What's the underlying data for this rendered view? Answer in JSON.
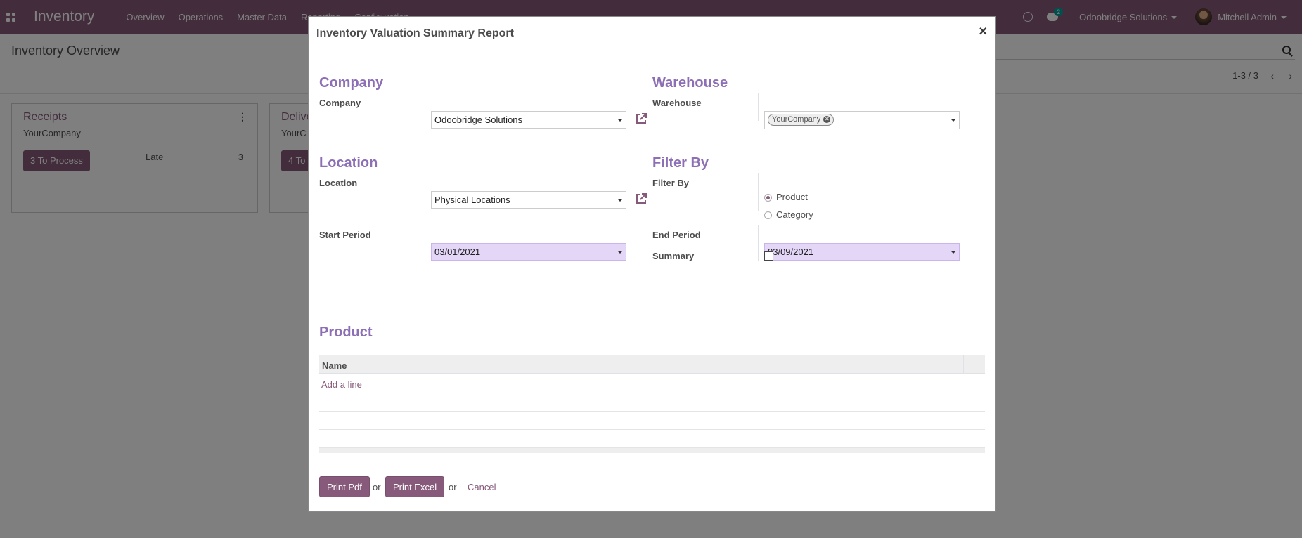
{
  "navbar": {
    "app_name": "Inventory",
    "menu": [
      "Overview",
      "Operations",
      "Master Data",
      "Reporting",
      "Configuration"
    ],
    "chat_count": "2",
    "company": "Odoobridge Solutions",
    "user": "Mitchell Admin"
  },
  "control_panel": {
    "title": "Inventory Overview",
    "pager": "1-3 / 3"
  },
  "cards": [
    {
      "title": "Receipts",
      "subtitle": "YourCompany",
      "button": "3 To Process",
      "late_label": "Late",
      "late_count": "3"
    },
    {
      "title": "Delive",
      "subtitle": "YourC",
      "button": "4 To"
    }
  ],
  "modal": {
    "title": "Inventory Valuation Summary Report",
    "close": "×",
    "company_group": {
      "title": "Company",
      "label": "Company",
      "value": "Odoobridge Solutions"
    },
    "warehouse_group": {
      "title": "Warehouse",
      "label": "Warehouse",
      "tag": "YourCompany"
    },
    "location_group": {
      "title": "Location",
      "label": "Location",
      "value": "Physical Locations"
    },
    "filter_group": {
      "title": "Filter By",
      "label": "Filter By",
      "options": [
        {
          "label": "Product",
          "checked": true
        },
        {
          "label": "Category",
          "checked": false
        }
      ]
    },
    "start_period": {
      "label": "Start Period",
      "value": "03/01/2021"
    },
    "end_period": {
      "label": "End Period",
      "value": "03/09/2021"
    },
    "summary": {
      "label": "Summary",
      "checked": false
    },
    "product_group": {
      "title": "Product",
      "column": "Name",
      "add_line": "Add a line"
    },
    "footer": {
      "print_pdf": "Print Pdf",
      "or1": "or",
      "print_excel": "Print Excel",
      "or2": "or",
      "cancel": "Cancel"
    }
  },
  "colors": {
    "brand": "#875a7b",
    "section": "#8c6fb4",
    "date_bg": "#e3d6f7"
  }
}
